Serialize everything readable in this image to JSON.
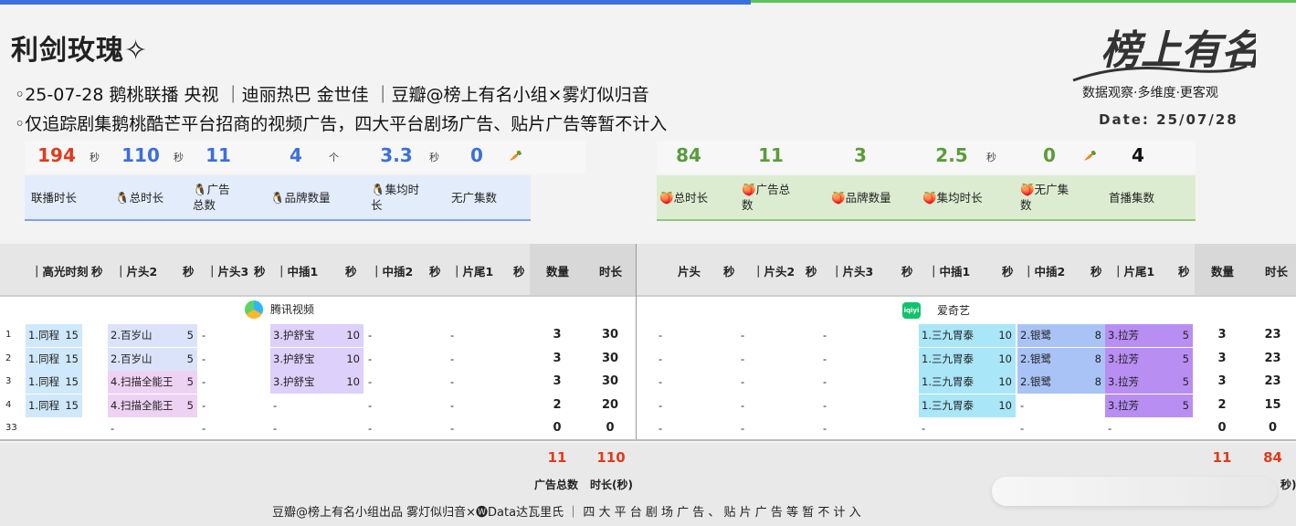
{
  "title": "利剑玫瑰✧",
  "info_lines": [
    "◦25-07-28 鹅桃联播 央视 ｜迪丽热巴 金世佳 ｜豆瓣@榜上有名小组×雾灯似归音",
    "◦仅追踪剧集鹅桃酷芒平台招商的视频广告，四大平台剧场广告、贴片广告等暂不计入"
  ],
  "logo_text": "榜上有名",
  "tagline": "数据观察·多维度·更客观",
  "date": "Date: 25/07/28",
  "stats_left": [
    {
      "value": "194",
      "unit": "秒",
      "color": "#e03b1c"
    },
    {
      "value": "110",
      "unit": "秒",
      "color": "#3b6fe0"
    },
    {
      "value": "11",
      "unit": "",
      "color": "#3b6fe0"
    },
    {
      "value": "4",
      "unit": "个",
      "color": "#3b6fe0"
    },
    {
      "value": "3.3",
      "unit": "秒",
      "color": "#3b6fe0"
    },
    {
      "value": "0",
      "unit": "🥕",
      "color": "#3b6fe0"
    }
  ],
  "labels_left": [
    "联播时长",
    "🐧总时长",
    "🐧广告\n总数",
    "🐧品牌数量",
    "🐧集均时\n长",
    "无广集数"
  ],
  "stats_right": [
    {
      "value": "84",
      "unit": "",
      "color": "#5a9c3a"
    },
    {
      "value": "11",
      "unit": "",
      "color": "#5a9c3a"
    },
    {
      "value": "3",
      "unit": "",
      "color": "#5a9c3a"
    },
    {
      "value": "2.5",
      "unit": "秒",
      "color": "#5a9c3a"
    },
    {
      "value": "0",
      "unit": "🥕",
      "color": "#5a9c3a"
    },
    {
      "value": "4",
      "unit": "",
      "color": "#111111"
    }
  ],
  "labels_right": [
    "🍑总时长",
    "🍑广告总\n数",
    "🍑品牌数量",
    "🍑集均时长",
    "🍑无广集\n数",
    "首播集数"
  ],
  "head_left": [
    "｜高光时刻",
    "秒",
    "｜片头2",
    "秒",
    "｜片头3",
    "秒",
    "｜中插1",
    "秒",
    "｜中插2",
    "秒",
    "｜片尾1",
    "秒",
    "数量",
    "时长"
  ],
  "head_right": [
    "片头",
    "秒",
    "｜片头2",
    "秒",
    "｜片头3",
    "秒",
    "｜中插1",
    "秒",
    "｜中插2",
    "秒",
    "｜片尾1",
    "秒",
    "数量",
    "时长"
  ],
  "platform_left": "腾讯视频",
  "platform_right": "爱奇艺",
  "iqiyi_icon_text": "iqiyi",
  "rows": [
    {
      "ep": "1",
      "l": [
        "1.同程",
        "15",
        "2.百岁山",
        "5",
        "-",
        "",
        "3.护舒宝",
        "10",
        "-",
        "",
        "-",
        ""
      ],
      "lc": "3",
      "ld": "30",
      "r": [
        "-",
        "",
        "-",
        "",
        "-",
        "",
        "1.三九胃泰",
        "10",
        "2.银鹭",
        "8",
        "3.拉芳",
        "5"
      ],
      "rc": "3",
      "rd": "23"
    },
    {
      "ep": "2",
      "l": [
        "1.同程",
        "15",
        "2.百岁山",
        "5",
        "-",
        "",
        "3.护舒宝",
        "10",
        "-",
        "",
        "-",
        ""
      ],
      "lc": "3",
      "ld": "30",
      "r": [
        "-",
        "",
        "-",
        "",
        "-",
        "",
        "1.三九胃泰",
        "10",
        "2.银鹭",
        "8",
        "3.拉芳",
        "5"
      ],
      "rc": "3",
      "rd": "23"
    },
    {
      "ep": "3",
      "l": [
        "1.同程",
        "15",
        "4.扫描全能王",
        "5",
        "-",
        "",
        "3.护舒宝",
        "10",
        "-",
        "",
        "-",
        ""
      ],
      "lc": "3",
      "ld": "30",
      "r": [
        "-",
        "",
        "-",
        "",
        "-",
        "",
        "1.三九胃泰",
        "10",
        "2.银鹭",
        "8",
        "3.拉芳",
        "5"
      ],
      "rc": "3",
      "rd": "23"
    },
    {
      "ep": "4",
      "l": [
        "1.同程",
        "15",
        "4.扫描全能王",
        "5",
        "-",
        "",
        "-",
        "",
        "-",
        "",
        "-",
        ""
      ],
      "lc": "2",
      "ld": "20",
      "r": [
        "-",
        "",
        "-",
        "",
        "-",
        "",
        "1.三九胃泰",
        "10",
        "-",
        "",
        "3.拉芳",
        "5"
      ],
      "rc": "2",
      "rd": "15"
    },
    {
      "ep": "33",
      "l": [
        "",
        "",
        "-",
        "",
        "-",
        "",
        "-",
        "",
        "-",
        "",
        "-",
        ""
      ],
      "lc": "0",
      "ld": "0",
      "r": [
        "-",
        "",
        "-",
        "",
        "-",
        "",
        "-",
        "",
        "-",
        "",
        "-",
        ""
      ],
      "rc": "0",
      "rd": "0"
    }
  ],
  "total_left_count": "11",
  "total_left_dur": "110",
  "total_right_count": "11",
  "total_right_dur": "84",
  "total_label_count": "广告总数",
  "total_label_dur": "时长(秒)",
  "total_label_dur_right": "秒)",
  "footer_note": "豆瓣@榜上有名小组出品 雾灯似归音×🅦Data达瓦里氏 ｜ 四 大 平 台 剧 场 广 告 、 贴 片 广 告 等 暂 不 计 入",
  "colors": {
    "tongcheng": "#cfe8fb",
    "baisuishan": "#dbe3fb",
    "saomiao": "#eed2f3",
    "hushubao": "#ddd0fb",
    "sanjiu": "#a9e6f7",
    "yinlu": "#a9c3f6",
    "lafang": "#b88ef3"
  }
}
